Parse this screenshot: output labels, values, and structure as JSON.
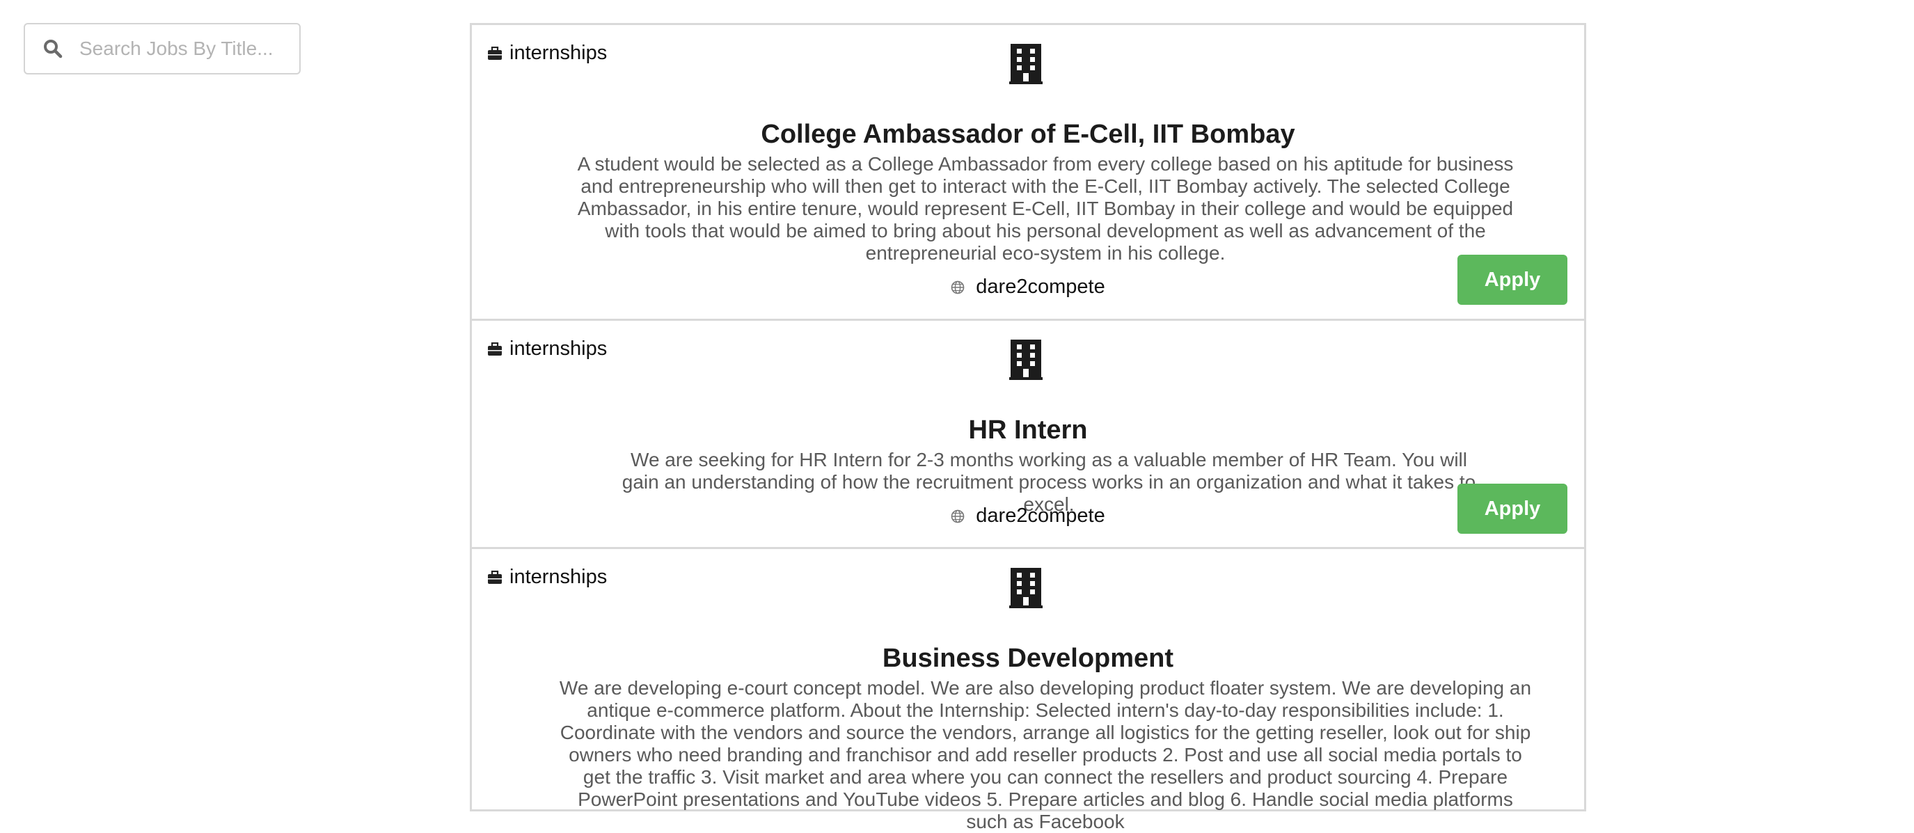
{
  "search": {
    "placeholder": "Search Jobs By Title...",
    "value": ""
  },
  "icons": {
    "search": "search-icon",
    "category": "briefcase-icon",
    "company_logo": "building-icon",
    "company": "globe-icon"
  },
  "colors": {
    "apply_button": "#5cb85c",
    "card_border": "#d9d9d9",
    "description_text": "#5a5a5a"
  },
  "jobs": [
    {
      "category": "internships",
      "title": "College Ambassador of E-Cell, IIT Bombay",
      "description": "A student would be selected as a College Ambassador from every college based on his aptitude for business and entrepreneurship who will then get to interact with the E-Cell, IIT Bombay actively. The selected College Ambassador, in his entire tenure, would represent E-Cell, IIT Bombay in their college and would be equipped with tools that would be aimed to bring about his personal development as well as advancement of the entrepreneurial eco-system in his college.",
      "company": "dare2compete",
      "apply_label": "Apply"
    },
    {
      "category": "internships",
      "title": "HR Intern",
      "description": "We are seeking for HR Intern for 2-3 months working as a valuable member of HR Team. You will gain an understanding of how the recruitment process works in an organization and what it takes to excel.",
      "company": "dare2compete",
      "apply_label": "Apply"
    },
    {
      "category": "internships",
      "title": "Business Development",
      "description": "We are developing e-court concept model. We are also developing product floater system. We are developing an antique e-commerce platform. About the Internship: Selected intern's day-to-day responsibilities include: 1. Coordinate with the vendors and source the vendors, arrange all logistics for the getting reseller, look out for ship owners who need branding and franchisor and add reseller products 2. Post and use all social media portals to get the traffic 3. Visit market and area where you can connect the resellers and product sourcing 4. Prepare PowerPoint presentations and YouTube videos 5. Prepare articles and blog 6. Handle social media platforms such as Facebook"
    }
  ]
}
